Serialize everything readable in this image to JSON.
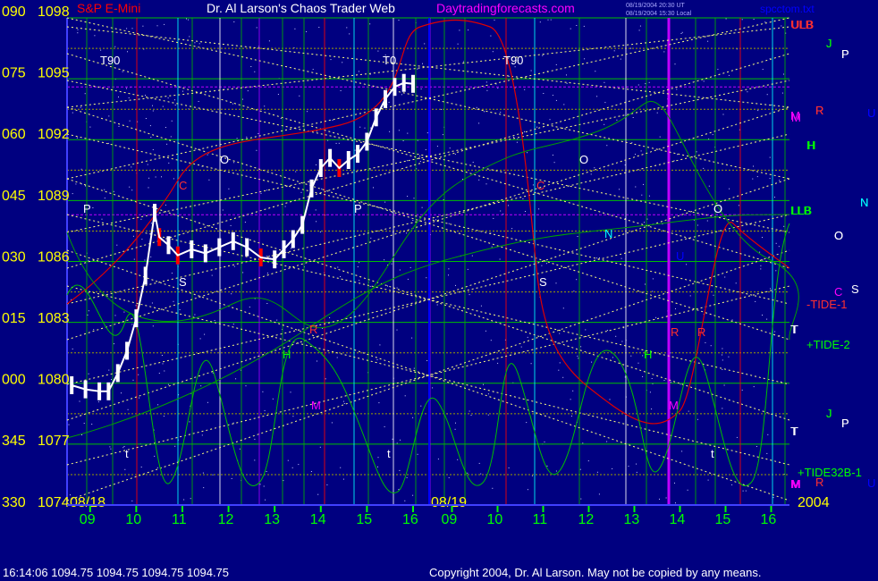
{
  "header": {
    "symbol_label": "S&P E-Mini",
    "web_title": "Dr. Al Larson's Chaos Trader Web",
    "site": "Daytradingforecasts.com",
    "stamp_1": "08/19/2004 20:30 UT",
    "stamp_2": "08/19/2004 15:30 Local",
    "file": "spcctom.txt"
  },
  "footer": {
    "quote": "16:14:06  1094.75 1094.75 1094.75 1094.75",
    "copyright": "Copyright 2004, Dr. Al Larson. May not be copied by any means."
  },
  "colors": {
    "background": "#000080",
    "price_bar": "#ffffff",
    "down_bar": "#ff0000",
    "left_axis": "#ffff00",
    "time_axis": "#00ff00",
    "grid": "#ffff00"
  },
  "chart_data": {
    "type": "line",
    "title": "S&P E-Mini",
    "y_price_ticks": [
      "1098",
      "1095",
      "1092",
      "1089",
      "1086",
      "1083",
      "1080",
      "1077",
      "1074"
    ],
    "y_angle_ticks": [
      "090",
      "075",
      "060",
      "045",
      "030",
      "015",
      "000",
      "345",
      "330"
    ],
    "ylim": [
      1074,
      1098
    ],
    "date_labels": [
      "08/18",
      "08/19",
      "2004"
    ],
    "hour_labels": [
      "09",
      "10",
      "11",
      "12",
      "13",
      "14",
      "15",
      "16",
      "09",
      "10",
      "11",
      "12",
      "13",
      "14",
      "15",
      "16"
    ],
    "day1_hours": [
      9,
      10,
      11,
      12,
      13,
      14,
      15,
      16
    ],
    "day2_hours": [
      9,
      10,
      11,
      12,
      13,
      14,
      15,
      16
    ],
    "series": [
      {
        "name": "S&P E-Mini",
        "x": [
          8.6,
          8.9,
          9.2,
          9.4,
          9.6,
          9.8,
          10.0,
          10.2,
          10.4,
          10.5,
          10.7,
          10.9,
          11.2,
          11.5,
          11.8,
          12.1,
          12.4,
          12.7,
          13.0,
          13.2,
          13.4,
          13.6,
          13.8,
          14.0,
          14.2,
          14.4,
          14.6,
          14.8,
          15.0,
          15.2,
          15.4,
          15.6,
          15.8,
          16.0
        ],
        "y": [
          1079.9,
          1079.7,
          1079.6,
          1079.6,
          1080.5,
          1081.6,
          1083.2,
          1085.3,
          1088.4,
          1087.2,
          1086.8,
          1086.3,
          1086.6,
          1086.4,
          1086.7,
          1087.0,
          1086.7,
          1086.2,
          1086.1,
          1086.6,
          1087.1,
          1087.8,
          1089.6,
          1090.6,
          1091.1,
          1090.6,
          1091.0,
          1091.3,
          1091.9,
          1093.1,
          1094.0,
          1094.6,
          1094.8,
          1094.75
        ]
      }
    ],
    "guide_letters": [
      "T90",
      "T0",
      "T90",
      "ULB",
      "M",
      "H",
      "LLB",
      "T",
      "T",
      "M",
      "P",
      "O",
      "P",
      "C",
      "S",
      "R",
      "H",
      "M",
      "J",
      "P",
      "R",
      "U",
      "N",
      "O",
      "C",
      "S",
      "J",
      "P",
      "R",
      "U",
      "O",
      "N",
      "O",
      "H",
      "R",
      "M",
      "t",
      "t",
      "t"
    ],
    "legend_right": [
      "ULB",
      "M",
      "H",
      "LLB",
      "-TIDE-1",
      "T",
      "+TIDE-2",
      "T",
      "+TIDE32B-1",
      "M"
    ],
    "legend_right_letters": [
      "J",
      "P",
      "R",
      "U",
      "H",
      "N",
      "O",
      "C",
      "S",
      "J",
      "P",
      "R",
      "U"
    ],
    "grid": true
  }
}
